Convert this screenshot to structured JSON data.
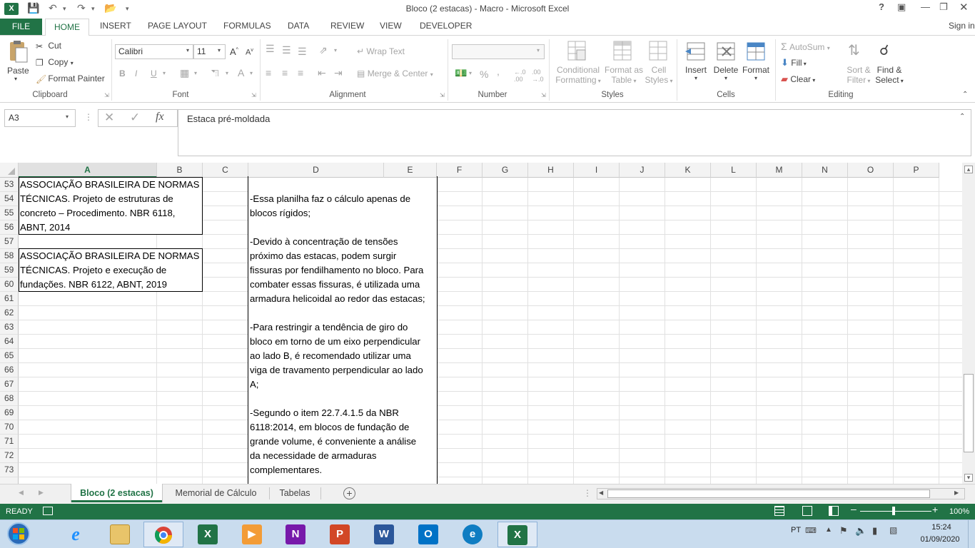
{
  "window": {
    "title": "Bloco (2 estacas) - Macro - Microsoft Excel",
    "help": "?",
    "signin": "Sign in"
  },
  "ribbon_tabs": [
    "FILE",
    "HOME",
    "INSERT",
    "PAGE LAYOUT",
    "FORMULAS",
    "DATA",
    "REVIEW",
    "VIEW",
    "DEVELOPER"
  ],
  "clipboard": {
    "paste": "Paste",
    "cut": "Cut",
    "copy": "Copy",
    "format_painter": "Format Painter",
    "label": "Clipboard"
  },
  "font": {
    "name": "Calibri",
    "size": "11",
    "bold": "B",
    "italic": "I",
    "underline": "U",
    "label": "Font"
  },
  "alignment": {
    "wrap": "Wrap Text",
    "merge": "Merge & Center",
    "label": "Alignment"
  },
  "number": {
    "percent": "%",
    "comma": ",",
    "label": "Number"
  },
  "styles": {
    "conditional_1": "Conditional",
    "conditional_2": "Formatting",
    "format_table_1": "Format as",
    "format_table_2": "Table",
    "cell_styles_1": "Cell",
    "cell_styles_2": "Styles",
    "label": "Styles"
  },
  "cells": {
    "insert": "Insert",
    "delete": "Delete",
    "format": "Format",
    "label": "Cells"
  },
  "editing": {
    "autosum": "AutoSum",
    "fill": "Fill",
    "clear": "Clear",
    "sort_1": "Sort &",
    "sort_2": "Filter",
    "find_1": "Find &",
    "find_2": "Select",
    "label": "Editing"
  },
  "formula_bar": {
    "name_box": "A3",
    "fx": "fx",
    "content": "Estaca pré-moldada"
  },
  "columns": [
    "A",
    "B",
    "C",
    "D",
    "E",
    "F",
    "G",
    "H",
    "I",
    "J",
    "K",
    "L",
    "M",
    "N",
    "O",
    "P"
  ],
  "rows": [
    "53",
    "54",
    "55",
    "56",
    "57",
    "58",
    "59",
    "60",
    "61",
    "62",
    "63",
    "64",
    "65",
    "66",
    "67",
    "68",
    "69",
    "70",
    "71",
    "72",
    "73"
  ],
  "references": [
    [
      "ASSOCIAÇÃO BRASILEIRA DE NORMAS",
      "TÉCNICAS. Projeto de estruturas de",
      "concreto – Procedimento. NBR 6118,",
      "ABNT, 2014"
    ],
    [
      "ASSOCIAÇÃO BRASILEIRA DE NORMAS",
      "TÉCNICAS. Projeto e execução de",
      "fundações. NBR 6122, ABNT, 2019"
    ]
  ],
  "notes": [
    "-Essa planilha faz o cálculo apenas de",
    "blocos rígidos;",
    "",
    "-Devido à concentração de tensões",
    "próximo das estacas, podem surgir",
    "fissuras por fendilhamento no bloco. Para",
    "combater essas fissuras, é utilizada uma",
    "armadura helicoidal ao redor das estacas;",
    "",
    "-Para restringir a tendência de giro do",
    "bloco em torno de um eixo perpendicular",
    "ao lado B, é recomendado utilizar uma",
    "viga de travamento perpendicular ao lado",
    "A;",
    "",
    "-Segundo o item 22.7.4.1.5 da NBR",
    "6118:2014, em blocos de fundação de",
    "grande volume, é conveniente a análise",
    "da necessidade de armaduras",
    "complementares."
  ],
  "sheets": [
    "Bloco (2 estacas)",
    "Memorial de Cálculo",
    "Tabelas"
  ],
  "status": {
    "ready": "READY",
    "zoom": "100%"
  },
  "taskbar": {
    "lang": "PT",
    "time": "15:24",
    "date": "01/09/2020"
  },
  "colors": {
    "excel_green": "#217346",
    "taskbar": "#c9dcee"
  }
}
